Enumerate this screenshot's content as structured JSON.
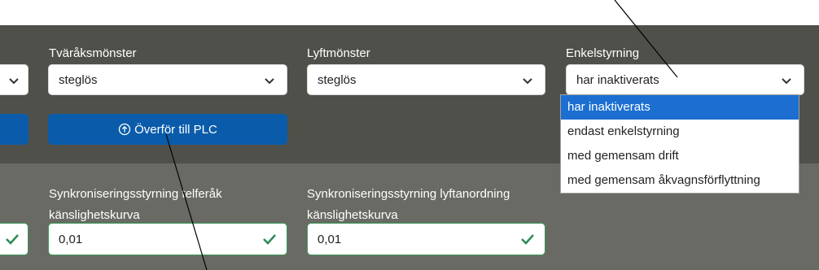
{
  "filters": {
    "traverse_pattern": {
      "label": "Tväråksmönster",
      "value": "steglös"
    },
    "lift_pattern": {
      "label": "Lyftmönster",
      "value": "steglös"
    },
    "single_control": {
      "label": "Enkelstyrning",
      "value": "har inaktiverats",
      "options": [
        "har inaktiverats",
        "endast enkelstyrning",
        "med gemensam drift",
        "med gemensam åkvagnsförflyttning"
      ],
      "selected_index": 0
    }
  },
  "actions": {
    "transfer_label": "Överför till PLC"
  },
  "sync": {
    "trolley": {
      "label": "Synkroniseringsstyrning telferåk känslighetskurva",
      "value": "0,01"
    },
    "lift": {
      "label": "Synkroniseringsstyrning lyftanordning känslighetskurva",
      "value": "0,01"
    }
  },
  "colors": {
    "header_dark": "#50504b",
    "section_mid": "#6a6a64",
    "primary_button": "#0a5caa",
    "selected_option": "#1c6fd1",
    "valid_check": "#2e8b57"
  }
}
